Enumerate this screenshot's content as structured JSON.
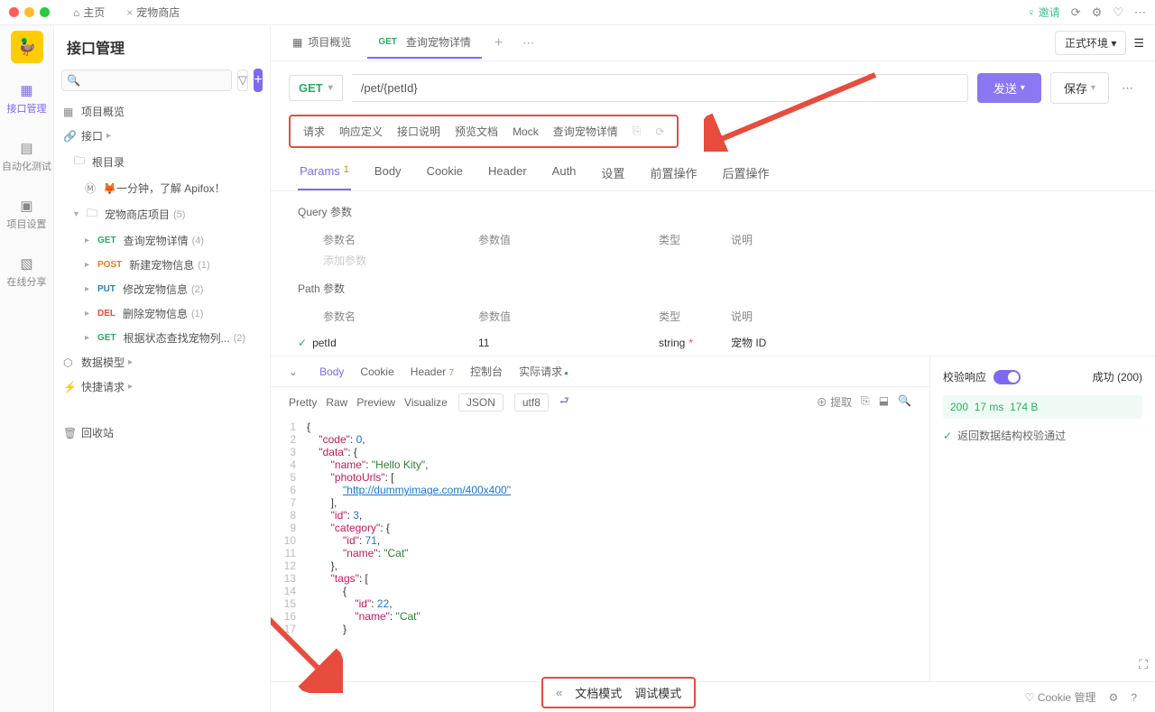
{
  "titlebar": {
    "tab_home": "主页",
    "tab_store": "宠物商店",
    "invite": "邀请"
  },
  "rail": {
    "api": "接口管理",
    "auto_test": "自动化测试",
    "settings": "项目设置",
    "share": "在线分享"
  },
  "sidebar": {
    "title": "接口管理",
    "overview": "项目概览",
    "api": "接口",
    "root": "根目录",
    "intro": "🦊一分钟，了解 Apifox！",
    "project": "宠物商店项目",
    "project_count": "(5)",
    "items": [
      {
        "method": "GET",
        "mclass": "m-get",
        "name": "查询宠物详情",
        "count": "(4)"
      },
      {
        "method": "POST",
        "mclass": "m-post",
        "name": "新建宠物信息",
        "count": "(1)"
      },
      {
        "method": "PUT",
        "mclass": "m-put",
        "name": "修改宠物信息",
        "count": "(2)"
      },
      {
        "method": "DEL",
        "mclass": "m-del",
        "name": "删除宠物信息",
        "count": "(1)"
      },
      {
        "method": "GET",
        "mclass": "m-get",
        "name": "根据状态查找宠物列...",
        "count": "(2)"
      }
    ],
    "data_model": "数据模型",
    "quick_req": "快捷请求",
    "recycle": "回收站"
  },
  "tabs": {
    "overview": "项目概览",
    "active_method": "GET",
    "active_name": "查询宠物详情",
    "env": "正式环境"
  },
  "request": {
    "method": "GET",
    "url": "/pet/{petId}",
    "send": "发送",
    "save": "保存"
  },
  "subtabs": {
    "t1": "请求",
    "t2": "响应定义",
    "t3": "接口说明",
    "t4": "预览文档",
    "t5": "Mock",
    "t6": "查询宠物详情"
  },
  "ptabs": {
    "params": "Params",
    "params_cnt": "1",
    "body": "Body",
    "cookie": "Cookie",
    "header": "Header",
    "auth": "Auth",
    "settings": "设置",
    "pre": "前置操作",
    "post": "后置操作"
  },
  "query": {
    "title": "Query 参数",
    "h_name": "参数名",
    "h_val": "参数值",
    "h_type": "类型",
    "h_desc": "说明",
    "add": "添加参数"
  },
  "path": {
    "title": "Path 参数",
    "h_name": "参数名",
    "h_val": "参数值",
    "h_type": "类型",
    "h_desc": "说明",
    "row_name": "petId",
    "row_val": "11",
    "row_type": "string",
    "row_desc": "宠物 ID"
  },
  "resp": {
    "body": "Body",
    "cookie": "Cookie",
    "header": "Header",
    "header_cnt": "7",
    "console": "控制台",
    "actual": "实际请求",
    "pretty": "Pretty",
    "raw": "Raw",
    "preview": "Preview",
    "visualize": "Visualize",
    "json": "JSON",
    "utf8": "utf8",
    "extract": "提取",
    "validate_label": "校验响应",
    "success": "成功 (200)",
    "stats_code": "200",
    "stats_time": "17 ms",
    "stats_size": "174 B",
    "valid_msg": "返回数据结构校验通过"
  },
  "code": [
    {
      "n": 1,
      "t": "{"
    },
    {
      "n": 2,
      "t": "    \"code\": 0,"
    },
    {
      "n": 3,
      "t": "    \"data\": {"
    },
    {
      "n": 4,
      "t": "        \"name\": \"Hello Kity\","
    },
    {
      "n": 5,
      "t": "        \"photoUrls\": ["
    },
    {
      "n": 6,
      "t": "            \"http://dummyimage.com/400x400\""
    },
    {
      "n": 7,
      "t": "        ],"
    },
    {
      "n": 8,
      "t": "        \"id\": 3,"
    },
    {
      "n": 9,
      "t": "        \"category\": {"
    },
    {
      "n": 10,
      "t": "            \"id\": 71,"
    },
    {
      "n": 11,
      "t": "            \"name\": \"Cat\""
    },
    {
      "n": 12,
      "t": "        },"
    },
    {
      "n": 13,
      "t": "        \"tags\": ["
    },
    {
      "n": 14,
      "t": "            {"
    },
    {
      "n": 15,
      "t": "                \"id\": 22,"
    },
    {
      "n": 16,
      "t": "                \"name\": \"Cat\""
    },
    {
      "n": 17,
      "t": "            }"
    }
  ],
  "bottom": {
    "doc": "文档模式",
    "debug": "调试模式",
    "cookie": "Cookie 管理"
  }
}
